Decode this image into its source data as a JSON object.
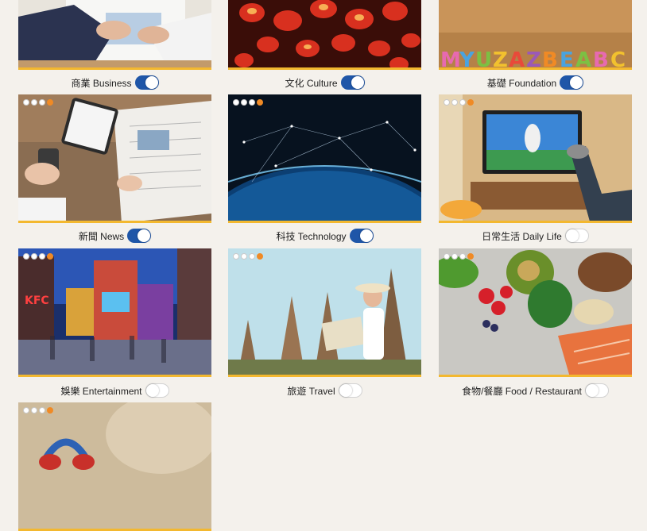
{
  "categories": [
    {
      "label": "商業 Business",
      "enabled": true
    },
    {
      "label": "文化 Culture",
      "enabled": true
    },
    {
      "label": "基礎 Foundation",
      "enabled": true
    },
    {
      "label": "新聞 News",
      "enabled": true
    },
    {
      "label": "科技 Technology",
      "enabled": true
    },
    {
      "label": "日常生活 Daily Life",
      "enabled": false
    },
    {
      "label": "娛樂 Entertainment",
      "enabled": false
    },
    {
      "label": "旅遊 Travel",
      "enabled": false
    },
    {
      "label": "食物/餐廳 Food / Restaurant",
      "enabled": false
    },
    {
      "label": "",
      "enabled": false
    }
  ],
  "colors": {
    "accent": "#1f56a8",
    "underline": "#f3b82f",
    "background": "#f4f1ec"
  }
}
